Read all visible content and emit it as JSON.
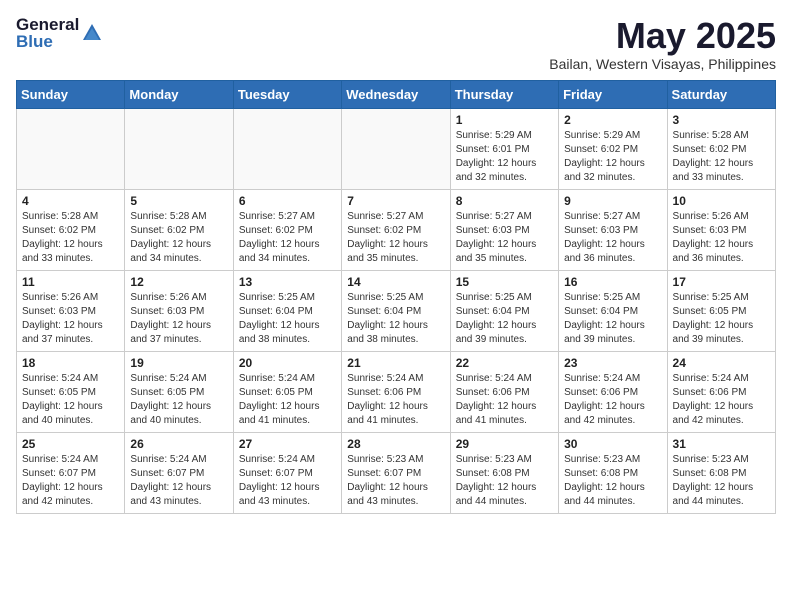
{
  "header": {
    "logo_general": "General",
    "logo_blue": "Blue",
    "month_year": "May 2025",
    "location": "Bailan, Western Visayas, Philippines"
  },
  "weekdays": [
    "Sunday",
    "Monday",
    "Tuesday",
    "Wednesday",
    "Thursday",
    "Friday",
    "Saturday"
  ],
  "weeks": [
    [
      {
        "day": "",
        "info": ""
      },
      {
        "day": "",
        "info": ""
      },
      {
        "day": "",
        "info": ""
      },
      {
        "day": "",
        "info": ""
      },
      {
        "day": "1",
        "info": "Sunrise: 5:29 AM\nSunset: 6:01 PM\nDaylight: 12 hours\nand 32 minutes."
      },
      {
        "day": "2",
        "info": "Sunrise: 5:29 AM\nSunset: 6:02 PM\nDaylight: 12 hours\nand 32 minutes."
      },
      {
        "day": "3",
        "info": "Sunrise: 5:28 AM\nSunset: 6:02 PM\nDaylight: 12 hours\nand 33 minutes."
      }
    ],
    [
      {
        "day": "4",
        "info": "Sunrise: 5:28 AM\nSunset: 6:02 PM\nDaylight: 12 hours\nand 33 minutes."
      },
      {
        "day": "5",
        "info": "Sunrise: 5:28 AM\nSunset: 6:02 PM\nDaylight: 12 hours\nand 34 minutes."
      },
      {
        "day": "6",
        "info": "Sunrise: 5:27 AM\nSunset: 6:02 PM\nDaylight: 12 hours\nand 34 minutes."
      },
      {
        "day": "7",
        "info": "Sunrise: 5:27 AM\nSunset: 6:02 PM\nDaylight: 12 hours\nand 35 minutes."
      },
      {
        "day": "8",
        "info": "Sunrise: 5:27 AM\nSunset: 6:03 PM\nDaylight: 12 hours\nand 35 minutes."
      },
      {
        "day": "9",
        "info": "Sunrise: 5:27 AM\nSunset: 6:03 PM\nDaylight: 12 hours\nand 36 minutes."
      },
      {
        "day": "10",
        "info": "Sunrise: 5:26 AM\nSunset: 6:03 PM\nDaylight: 12 hours\nand 36 minutes."
      }
    ],
    [
      {
        "day": "11",
        "info": "Sunrise: 5:26 AM\nSunset: 6:03 PM\nDaylight: 12 hours\nand 37 minutes."
      },
      {
        "day": "12",
        "info": "Sunrise: 5:26 AM\nSunset: 6:03 PM\nDaylight: 12 hours\nand 37 minutes."
      },
      {
        "day": "13",
        "info": "Sunrise: 5:25 AM\nSunset: 6:04 PM\nDaylight: 12 hours\nand 38 minutes."
      },
      {
        "day": "14",
        "info": "Sunrise: 5:25 AM\nSunset: 6:04 PM\nDaylight: 12 hours\nand 38 minutes."
      },
      {
        "day": "15",
        "info": "Sunrise: 5:25 AM\nSunset: 6:04 PM\nDaylight: 12 hours\nand 39 minutes."
      },
      {
        "day": "16",
        "info": "Sunrise: 5:25 AM\nSunset: 6:04 PM\nDaylight: 12 hours\nand 39 minutes."
      },
      {
        "day": "17",
        "info": "Sunrise: 5:25 AM\nSunset: 6:05 PM\nDaylight: 12 hours\nand 39 minutes."
      }
    ],
    [
      {
        "day": "18",
        "info": "Sunrise: 5:24 AM\nSunset: 6:05 PM\nDaylight: 12 hours\nand 40 minutes."
      },
      {
        "day": "19",
        "info": "Sunrise: 5:24 AM\nSunset: 6:05 PM\nDaylight: 12 hours\nand 40 minutes."
      },
      {
        "day": "20",
        "info": "Sunrise: 5:24 AM\nSunset: 6:05 PM\nDaylight: 12 hours\nand 41 minutes."
      },
      {
        "day": "21",
        "info": "Sunrise: 5:24 AM\nSunset: 6:06 PM\nDaylight: 12 hours\nand 41 minutes."
      },
      {
        "day": "22",
        "info": "Sunrise: 5:24 AM\nSunset: 6:06 PM\nDaylight: 12 hours\nand 41 minutes."
      },
      {
        "day": "23",
        "info": "Sunrise: 5:24 AM\nSunset: 6:06 PM\nDaylight: 12 hours\nand 42 minutes."
      },
      {
        "day": "24",
        "info": "Sunrise: 5:24 AM\nSunset: 6:06 PM\nDaylight: 12 hours\nand 42 minutes."
      }
    ],
    [
      {
        "day": "25",
        "info": "Sunrise: 5:24 AM\nSunset: 6:07 PM\nDaylight: 12 hours\nand 42 minutes."
      },
      {
        "day": "26",
        "info": "Sunrise: 5:24 AM\nSunset: 6:07 PM\nDaylight: 12 hours\nand 43 minutes."
      },
      {
        "day": "27",
        "info": "Sunrise: 5:24 AM\nSunset: 6:07 PM\nDaylight: 12 hours\nand 43 minutes."
      },
      {
        "day": "28",
        "info": "Sunrise: 5:23 AM\nSunset: 6:07 PM\nDaylight: 12 hours\nand 43 minutes."
      },
      {
        "day": "29",
        "info": "Sunrise: 5:23 AM\nSunset: 6:08 PM\nDaylight: 12 hours\nand 44 minutes."
      },
      {
        "day": "30",
        "info": "Sunrise: 5:23 AM\nSunset: 6:08 PM\nDaylight: 12 hours\nand 44 minutes."
      },
      {
        "day": "31",
        "info": "Sunrise: 5:23 AM\nSunset: 6:08 PM\nDaylight: 12 hours\nand 44 minutes."
      }
    ]
  ]
}
